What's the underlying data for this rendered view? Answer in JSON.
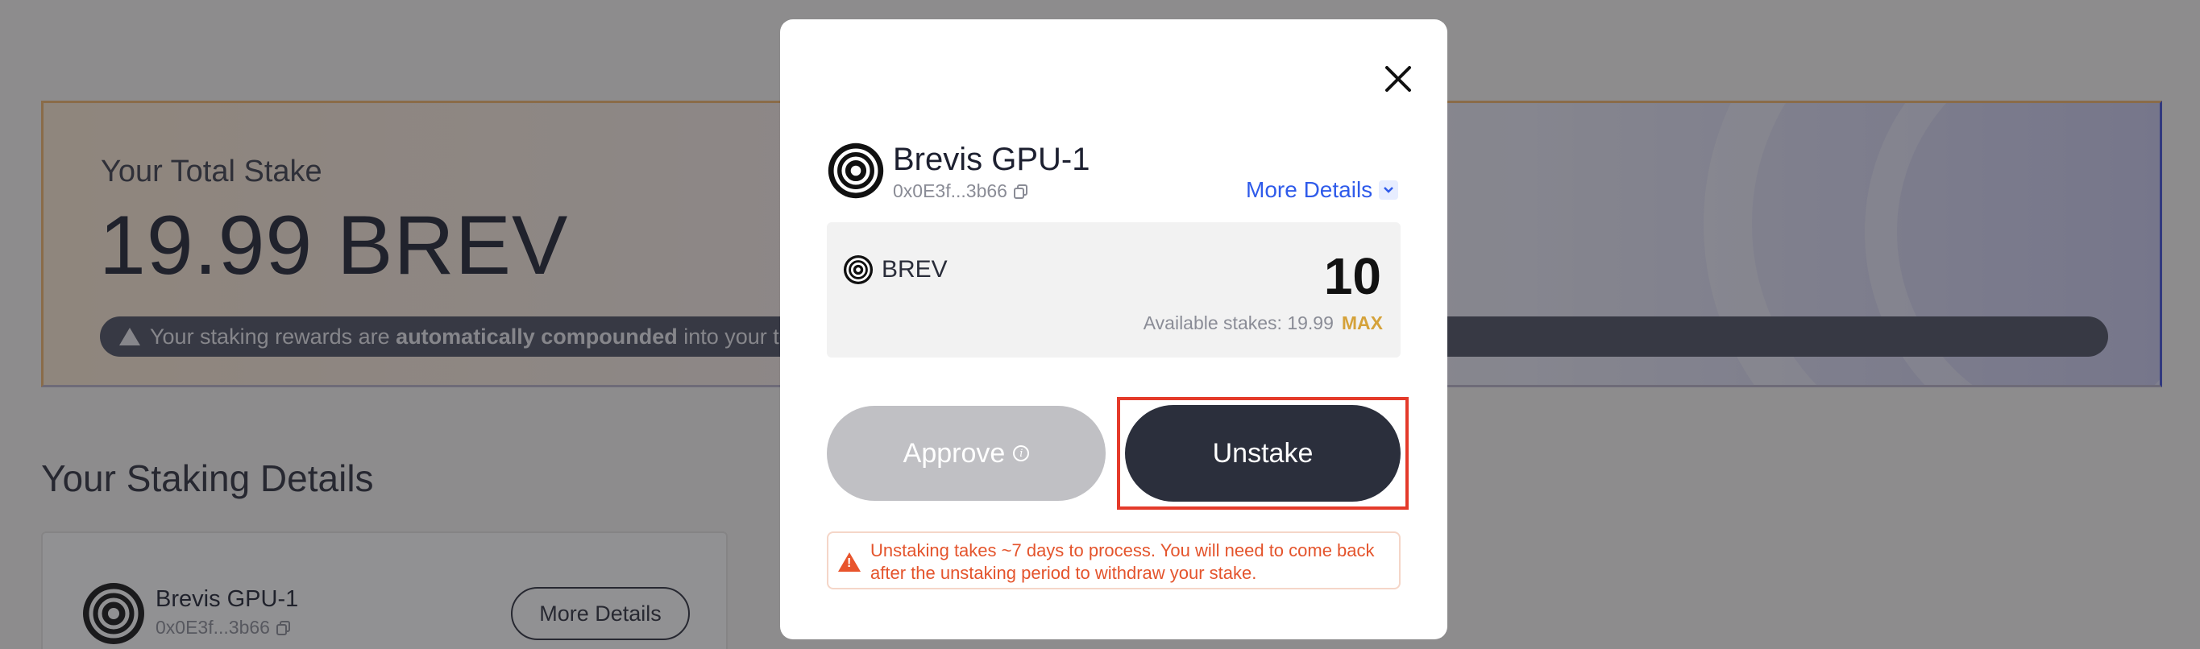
{
  "background": {
    "total_stake_label": "Your Total Stake",
    "total_stake_value": "19.99 BREV",
    "notice_pre": "Your staking rewards are ",
    "notice_bold": "automatically compounded",
    "notice_post": " into your to",
    "details_title": "Your Staking Details",
    "card": {
      "validator_name": "Brevis GPU-1",
      "validator_address": "0x0E3f...3b66",
      "more_details_label": "More Details"
    }
  },
  "modal": {
    "validator_name": "Brevis GPU-1",
    "validator_address": "0x0E3f...3b66",
    "more_details_label": "More Details",
    "token_symbol": "BREV",
    "amount": "10",
    "available_label": "Available stakes: 19.99",
    "max_label": "MAX",
    "approve_label": "Approve",
    "unstake_label": "Unstake",
    "warning_text": "Unstaking takes ~7 days to process. You will need to come back after the unstaking period to withdraw your stake."
  },
  "colors": {
    "accent_blue": "#2f5bea",
    "unstake_bg": "#2b2f3c",
    "highlight_red": "#e43a2a",
    "warning_orange": "#e4542c",
    "max_gold": "#d5a23a"
  },
  "icons": [
    "close-icon",
    "copy-icon",
    "chevron-down-icon",
    "info-icon",
    "warning-icon",
    "validator-logo-icon",
    "brev-token-icon"
  ]
}
